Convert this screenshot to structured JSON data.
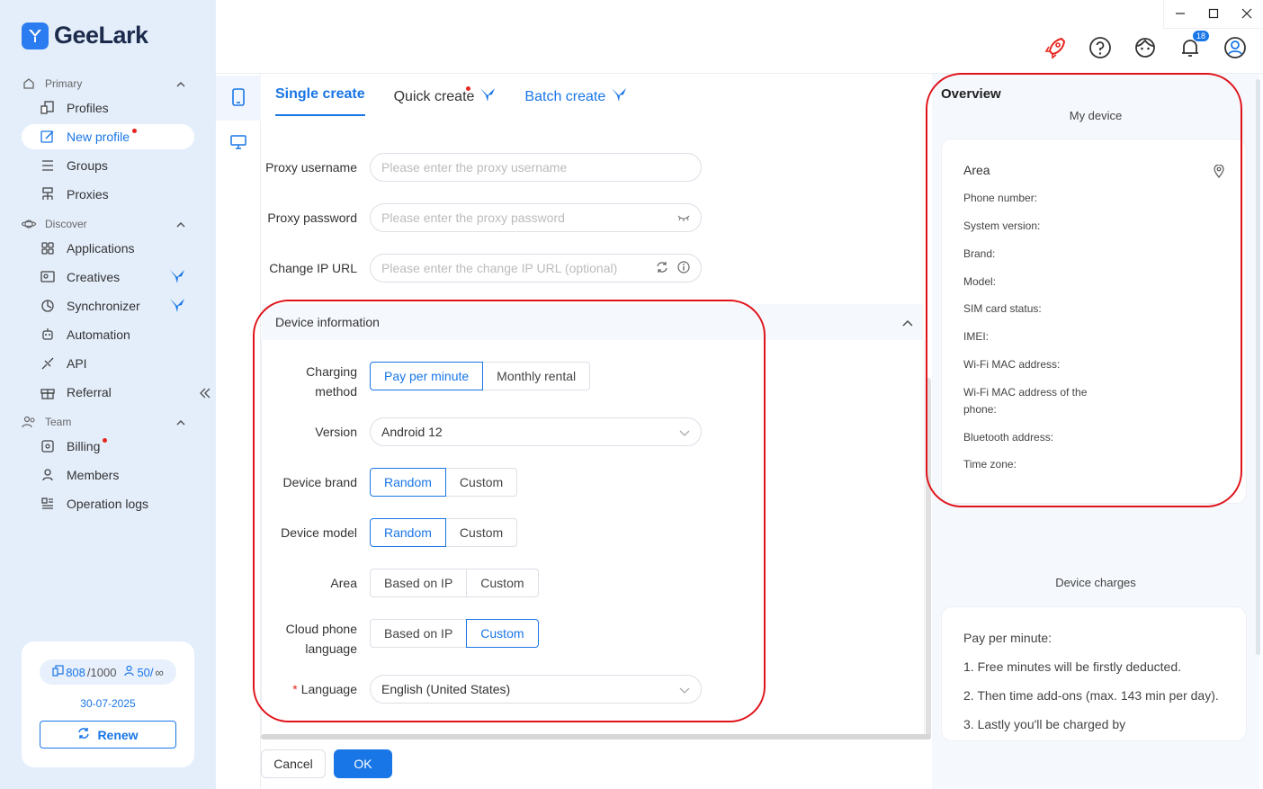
{
  "app": {
    "name": "GeeLark"
  },
  "sidebar": {
    "sections": [
      {
        "label": "Primary",
        "icon": "home-icon"
      },
      {
        "label": "Discover",
        "icon": "planet-icon"
      },
      {
        "label": "Team",
        "icon": "team-icon"
      }
    ],
    "items": [
      {
        "label": "Profiles",
        "icon": "profiles-icon"
      },
      {
        "label": "New profile",
        "icon": "edit-icon",
        "active": true,
        "dot": true
      },
      {
        "label": "Groups",
        "icon": "list-icon"
      },
      {
        "label": "Proxies",
        "icon": "network-icon"
      },
      {
        "label": "Applications",
        "icon": "apps-icon"
      },
      {
        "label": "Creatives",
        "icon": "creatives-icon",
        "bird": true
      },
      {
        "label": "Synchronizer",
        "icon": "sync-icon",
        "bird": true
      },
      {
        "label": "Automation",
        "icon": "robot-icon"
      },
      {
        "label": "API",
        "icon": "api-icon"
      },
      {
        "label": "Referral",
        "icon": "gift-icon"
      },
      {
        "label": "Billing",
        "icon": "billing-icon",
        "dot": true
      },
      {
        "label": "Members",
        "icon": "user-icon"
      },
      {
        "label": "Operation logs",
        "icon": "logs-icon"
      }
    ],
    "account": {
      "devices": "808",
      "devices_total": "/1000",
      "members": "50/",
      "members_total": "∞",
      "expiry": "30-07-2025",
      "renew_label": "Renew"
    }
  },
  "header": {
    "notification_count": "18"
  },
  "tabs": [
    {
      "label": "Single create",
      "active": true
    },
    {
      "label": "Quick create"
    },
    {
      "label": "Batch create"
    }
  ],
  "form": {
    "proxy_username": {
      "label": "Proxy username",
      "placeholder": "Please enter the proxy username"
    },
    "proxy_password": {
      "label": "Proxy password",
      "placeholder": "Please enter the proxy password"
    },
    "change_ip": {
      "label": "Change IP URL",
      "placeholder": "Please enter the change IP URL (optional)"
    },
    "device_info_title": "Device information",
    "charging": {
      "label_1": "Charging",
      "label_2": "method",
      "options": [
        "Pay per minute",
        "Monthly rental"
      ],
      "selected": "Pay per minute"
    },
    "version": {
      "label": "Version",
      "value": "Android 12"
    },
    "brand": {
      "label": "Device brand",
      "options": [
        "Random",
        "Custom"
      ],
      "selected": "Random"
    },
    "model": {
      "label": "Device model",
      "options": [
        "Random",
        "Custom"
      ],
      "selected": "Random"
    },
    "area": {
      "label": "Area",
      "options": [
        "Based on IP",
        "Custom"
      ],
      "selected": ""
    },
    "cloud_lang": {
      "label_1": "Cloud phone",
      "label_2": "language",
      "options": [
        "Based on IP",
        "Custom"
      ],
      "selected": "Custom"
    },
    "language": {
      "required_mark": "*",
      "label": "Language",
      "value": "English (United States)"
    },
    "cancel_label": "Cancel",
    "ok_label": "OK"
  },
  "overview": {
    "title": "Overview",
    "my_device": "My device",
    "area_label": "Area",
    "fields": [
      "Phone number:",
      "System version:",
      "Brand:",
      "Model:",
      "SIM card status:",
      "IMEI:",
      "Wi-Fi MAC address:",
      "Wi-Fi MAC address of the phone:",
      "Bluetooth address:",
      "Time zone:"
    ],
    "device_charges": "Device charges",
    "charges": [
      "Pay per minute:",
      "1. Free minutes will be firstly deducted.",
      "2. Then time add-ons (max. 143 min per day).",
      "3. Lastly you'll be charged by"
    ]
  },
  "colors": {
    "accent": "#1976e6",
    "sidebar_bg": "#e4eefb",
    "annotation": "#e0131a"
  }
}
